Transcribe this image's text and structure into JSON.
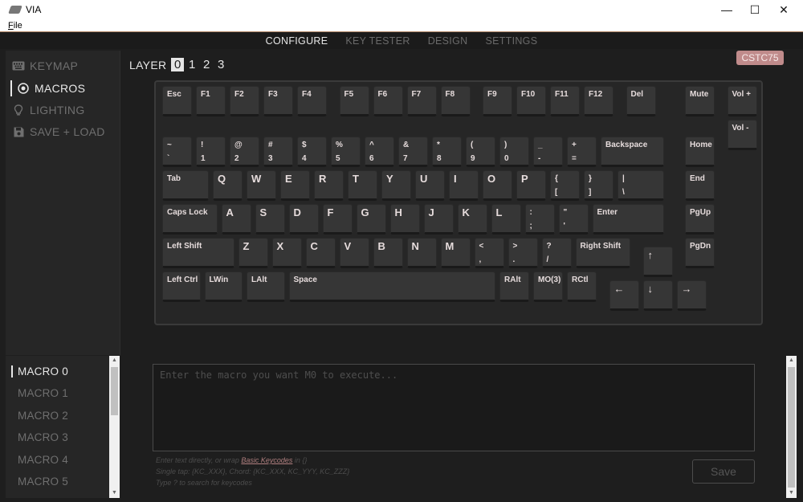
{
  "window": {
    "title": "VIA",
    "minimize": "—",
    "maximize": "☐",
    "close": "✕"
  },
  "menu": {
    "file": "File"
  },
  "topnav": {
    "tabs": [
      "CONFIGURE",
      "KEY TESTER",
      "DESIGN",
      "SETTINGS"
    ],
    "active_index": 0
  },
  "sidebar": {
    "items": [
      {
        "label": "KEYMAP",
        "icon": "keyboard-icon"
      },
      {
        "label": "MACROS",
        "icon": "record-icon"
      },
      {
        "label": "LIGHTING",
        "icon": "lightbulb-icon"
      },
      {
        "label": "SAVE + LOAD",
        "icon": "floppy-disk-icon"
      }
    ],
    "active_index": 1
  },
  "layer": {
    "label": "LAYER",
    "numbers": [
      "0",
      "1",
      "2",
      "3"
    ],
    "active_index": 0
  },
  "device_badge": "CSTC75",
  "keys": [
    {
      "t": "Esc"
    },
    {
      "t": "F1"
    },
    {
      "t": "F2"
    },
    {
      "t": "F3"
    },
    {
      "t": "F4"
    },
    {
      "t": "F5"
    },
    {
      "t": "F6"
    },
    {
      "t": "F7"
    },
    {
      "t": "F8"
    },
    {
      "t": "F9"
    },
    {
      "t": "F10"
    },
    {
      "t": "F11"
    },
    {
      "t": "F12"
    },
    {
      "t": "Del"
    },
    {
      "t": "Mute"
    },
    {
      "t": "Vol +"
    },
    {
      "t": "~",
      "b": "`"
    },
    {
      "t": "!",
      "b": "1"
    },
    {
      "t": "@",
      "b": "2"
    },
    {
      "t": "#",
      "b": "3"
    },
    {
      "t": "$",
      "b": "4"
    },
    {
      "t": "%",
      "b": "5"
    },
    {
      "t": "^",
      "b": "6"
    },
    {
      "t": "&",
      "b": "7"
    },
    {
      "t": "*",
      "b": "8"
    },
    {
      "t": "(",
      "b": "9"
    },
    {
      "t": ")",
      "b": "0"
    },
    {
      "t": "_",
      "b": "-"
    },
    {
      "t": "+",
      "b": "="
    },
    {
      "t": "Backspace"
    },
    {
      "t": "Home"
    },
    {
      "t": "Vol -"
    },
    {
      "t": "Tab"
    },
    {
      "t": "Q"
    },
    {
      "t": "W"
    },
    {
      "t": "E"
    },
    {
      "t": "R"
    },
    {
      "t": "T"
    },
    {
      "t": "Y"
    },
    {
      "t": "U"
    },
    {
      "t": "I"
    },
    {
      "t": "O"
    },
    {
      "t": "P"
    },
    {
      "t": "{",
      "b": "["
    },
    {
      "t": "}",
      "b": "]"
    },
    {
      "t": "|",
      "b": "\\"
    },
    {
      "t": "End"
    },
    {
      "t": "Caps Lock"
    },
    {
      "t": "A"
    },
    {
      "t": "S"
    },
    {
      "t": "D"
    },
    {
      "t": "F"
    },
    {
      "t": "G"
    },
    {
      "t": "H"
    },
    {
      "t": "J"
    },
    {
      "t": "K"
    },
    {
      "t": "L"
    },
    {
      "t": ":",
      "b": ";"
    },
    {
      "t": "\"",
      "b": "'"
    },
    {
      "t": "Enter"
    },
    {
      "t": "PgUp"
    },
    {
      "t": "Left Shift"
    },
    {
      "t": "Z"
    },
    {
      "t": "X"
    },
    {
      "t": "C"
    },
    {
      "t": "V"
    },
    {
      "t": "B"
    },
    {
      "t": "N"
    },
    {
      "t": "M"
    },
    {
      "t": "<",
      "b": ","
    },
    {
      "t": ">",
      "b": "."
    },
    {
      "t": "?",
      "b": "/"
    },
    {
      "t": "Right Shift"
    },
    {
      "t": "↑"
    },
    {
      "t": "PgDn"
    },
    {
      "t": "Left Ctrl"
    },
    {
      "t": "LWin"
    },
    {
      "t": "LAlt"
    },
    {
      "t": "Space"
    },
    {
      "t": "RAlt"
    },
    {
      "t": "MO(3)"
    },
    {
      "t": "RCtl"
    },
    {
      "t": "←"
    },
    {
      "t": "↓"
    },
    {
      "t": "→"
    }
  ],
  "macros": {
    "items": [
      "MACRO 0",
      "MACRO 1",
      "MACRO 2",
      "MACRO 3",
      "MACRO 4",
      "MACRO 5"
    ],
    "active_index": 0,
    "input_placeholder": "Enter the macro you want M0 to execute...",
    "hint_line1_pre": "Enter text directly, or wrap ",
    "hint_link": "Basic Keycodes",
    "hint_line1_post": " in {}",
    "hint_line2": "Single tap: {KC_XXX}, Chord: {KC_XXX, KC_YYY, KC_ZZZ}",
    "hint_line3": "Type ? to search for keycodes",
    "save_label": "Save"
  }
}
